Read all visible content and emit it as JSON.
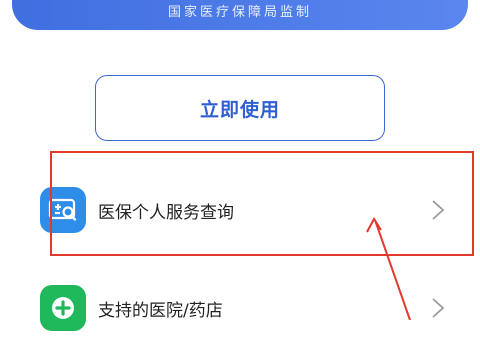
{
  "banner": {
    "text": "国家医疗保障局监制"
  },
  "primary_button": {
    "label": "立即使用"
  },
  "menu": [
    {
      "label": "医保个人服务查询",
      "icon": "search-card-icon",
      "color": "#2d8de8"
    },
    {
      "label": "支持的医院/药店",
      "icon": "plus-circle-icon",
      "color": "#1fb85a"
    }
  ],
  "annotation": {
    "highlight_color": "#e03a2f"
  }
}
